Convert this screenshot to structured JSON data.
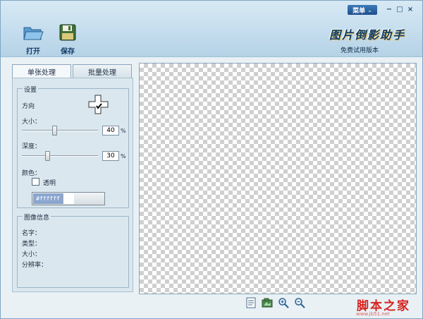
{
  "titlebar": {
    "menu_label": "菜单",
    "minimize": "−",
    "maximize": "□",
    "close": "×"
  },
  "toolbar": {
    "open_label": "打开",
    "save_label": "保存"
  },
  "brand": {
    "title": "图片倒影助手",
    "edition": "免费试用版本"
  },
  "tabs": [
    {
      "label": "单张处理"
    },
    {
      "label": "批量处理"
    }
  ],
  "settings": {
    "group_title": "设置",
    "direction_label": "方向",
    "size_label": "大小：",
    "size_value": "40",
    "size_unit": "%",
    "size_fraction": 0.4,
    "depth_label": "深度：",
    "depth_value": "30",
    "depth_unit": "%",
    "depth_fraction": 0.3,
    "color_label": "颜色：",
    "transparent_label": "透明",
    "color_hex": "#ffffff"
  },
  "image_info": {
    "group_title": "图像信息",
    "name_label": "名字：",
    "type_label": "类型：",
    "size_label": "大小：",
    "resolution_label": "分辨率："
  },
  "watermark": {
    "text": "脚本之家",
    "url": "www.jb51.net"
  }
}
